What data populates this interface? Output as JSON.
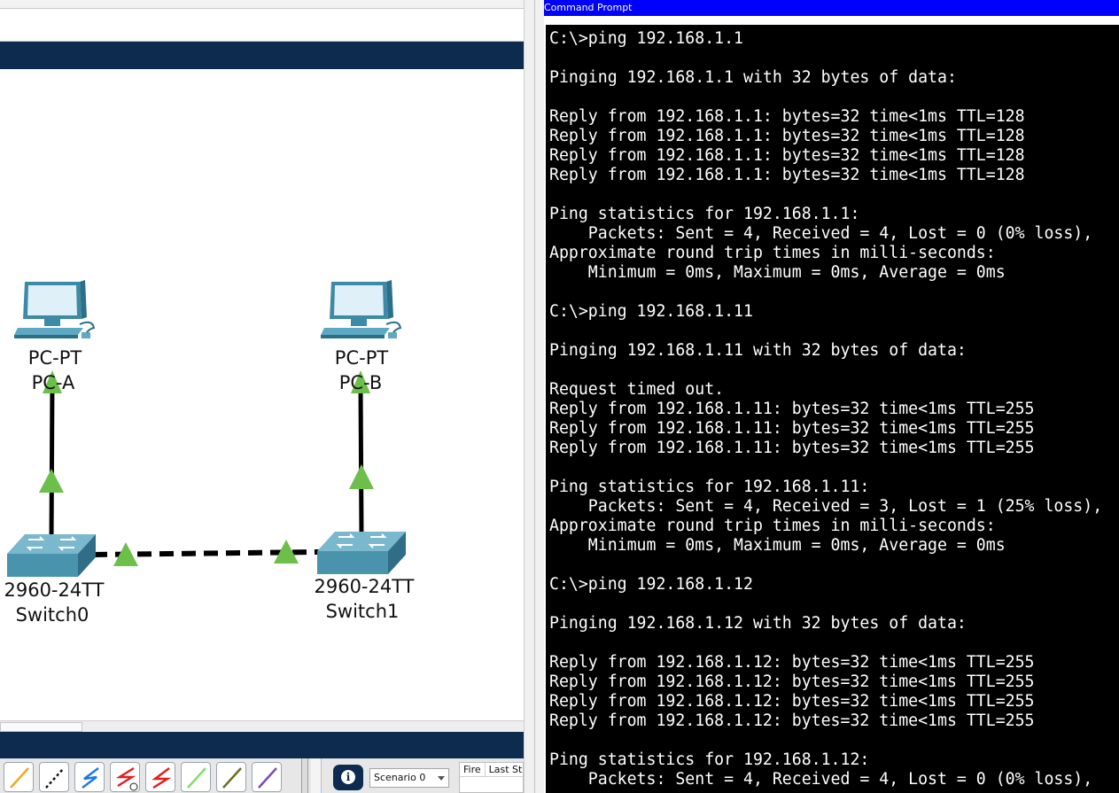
{
  "workspace": {
    "devices": [
      {
        "id": "pc-a",
        "model": "PC-PT",
        "name": "PC-A"
      },
      {
        "id": "pc-b",
        "model": "PC-PT",
        "name": "PC-B"
      },
      {
        "id": "switch0",
        "model": "2960-24TT",
        "name": "Switch0"
      },
      {
        "id": "switch1",
        "model": "2960-24TT",
        "name": "Switch1"
      }
    ],
    "link_status_color": "#6cbf4b",
    "link_color": "#000000"
  },
  "bottom_bar": {
    "connection_tools": [
      {
        "name": "console-cable",
        "color": "#f5a623"
      },
      {
        "name": "straight-through-cable",
        "color": "#111111"
      },
      {
        "name": "crossover-cable",
        "color": "#1e78e6"
      },
      {
        "name": "serial-dce-cable",
        "color": "#e02020"
      },
      {
        "name": "serial-dte-cable",
        "color": "#e02020"
      },
      {
        "name": "fiber-cable",
        "color": "#7ee06a"
      },
      {
        "name": "phone-cable",
        "color": "#6b6b1e"
      },
      {
        "name": "coaxial-cable",
        "color": "#7a4bb8"
      }
    ],
    "scenario": "Scenario 0",
    "pdu_columns": [
      "Fire",
      "Last Sta"
    ]
  },
  "command_prompt": {
    "title": "Command Prompt",
    "lines": [
      "C:\\>ping 192.168.1.1",
      "",
      "Pinging 192.168.1.1 with 32 bytes of data:",
      "",
      "Reply from 192.168.1.1: bytes=32 time<1ms TTL=128",
      "Reply from 192.168.1.1: bytes=32 time<1ms TTL=128",
      "Reply from 192.168.1.1: bytes=32 time<1ms TTL=128",
      "Reply from 192.168.1.1: bytes=32 time<1ms TTL=128",
      "",
      "Ping statistics for 192.168.1.1:",
      "    Packets: Sent = 4, Received = 4, Lost = 0 (0% loss),",
      "Approximate round trip times in milli-seconds:",
      "    Minimum = 0ms, Maximum = 0ms, Average = 0ms",
      "",
      "C:\\>ping 192.168.1.11",
      "",
      "Pinging 192.168.1.11 with 32 bytes of data:",
      "",
      "Request timed out.",
      "Reply from 192.168.1.11: bytes=32 time<1ms TTL=255",
      "Reply from 192.168.1.11: bytes=32 time<1ms TTL=255",
      "Reply from 192.168.1.11: bytes=32 time<1ms TTL=255",
      "",
      "Ping statistics for 192.168.1.11:",
      "    Packets: Sent = 4, Received = 3, Lost = 1 (25% loss),",
      "Approximate round trip times in milli-seconds:",
      "    Minimum = 0ms, Maximum = 0ms, Average = 0ms",
      "",
      "C:\\>ping 192.168.1.12",
      "",
      "Pinging 192.168.1.12 with 32 bytes of data:",
      "",
      "Reply from 192.168.1.12: bytes=32 time<1ms TTL=255",
      "Reply from 192.168.1.12: bytes=32 time<1ms TTL=255",
      "Reply from 192.168.1.12: bytes=32 time<1ms TTL=255",
      "Reply from 192.168.1.12: bytes=32 time<1ms TTL=255",
      "",
      "Ping statistics for 192.168.1.12:",
      "    Packets: Sent = 4, Received = 4, Lost = 0 (0% loss),"
    ]
  }
}
